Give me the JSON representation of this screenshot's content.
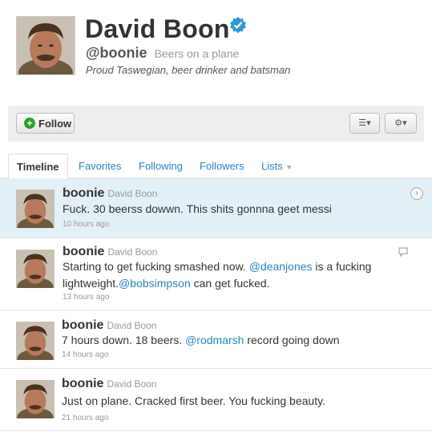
{
  "profile": {
    "name": "David Boon",
    "handle": "@boonie",
    "tagline": "Beers on a plane",
    "bio": "Proud Taswegian, beer drinker and batsman"
  },
  "actions": {
    "follow_label": "Follow",
    "list_icon": "list-icon",
    "gear_icon": "gear-icon"
  },
  "tabs": [
    {
      "label": "Timeline"
    },
    {
      "label": "Favorites"
    },
    {
      "label": "Following"
    },
    {
      "label": "Followers"
    },
    {
      "label": "Lists"
    }
  ],
  "tweets": [
    {
      "user": "boonie",
      "name": "David Boon",
      "text": "Fuck. 30 beerss dowwn. This shits gonnna geet messi",
      "time": "10 hours ago"
    },
    {
      "user": "boonie",
      "name": "David Boon",
      "text_parts": [
        "Starting to get fucking smashed now. ",
        "@deanjones",
        " is a fucking lightweight.",
        "@bobsimpson",
        " can get fucked."
      ],
      "time": "13 hours ago"
    },
    {
      "user": "boonie",
      "name": "David Boon",
      "text_parts": [
        "7 hours down. 18 beers. ",
        "@rodmarsh",
        " record going down"
      ],
      "time": "14 hours ago"
    },
    {
      "user": "boonie",
      "name": "David Boon",
      "text": "Just on plane. Cracked first beer. You fucking beauty.",
      "time": "21 hours ago"
    }
  ],
  "colors": {
    "link": "#2a85c0",
    "selected_bg": "#e4f0f7",
    "verified": "#2a9bd8"
  }
}
